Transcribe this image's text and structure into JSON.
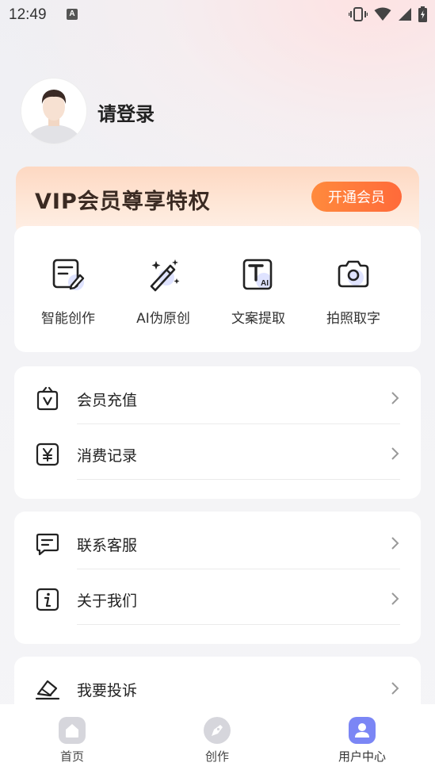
{
  "status_bar": {
    "time": "12:49",
    "notification_icon": "A"
  },
  "profile": {
    "login_label": "请登录"
  },
  "vip": {
    "title": "VIP会员尊享特权",
    "button_label": "开通会员",
    "accent": "#ff7a3c"
  },
  "tools": [
    {
      "label": "智能创作",
      "icon": "smart-create-icon"
    },
    {
      "label": "AI伪原创",
      "icon": "magic-wand-icon"
    },
    {
      "label": "文案提取",
      "icon": "text-extract-icon"
    },
    {
      "label": "拍照取字",
      "icon": "camera-icon"
    }
  ],
  "menu_group1": [
    {
      "label": "会员充值",
      "icon": "vip-recharge-icon"
    },
    {
      "label": "消费记录",
      "icon": "yen-record-icon"
    }
  ],
  "menu_group2": [
    {
      "label": "联系客服",
      "icon": "chat-service-icon"
    },
    {
      "label": "关于我们",
      "icon": "info-icon"
    }
  ],
  "menu_group3": [
    {
      "label": "我要投诉",
      "icon": "complaint-icon"
    }
  ],
  "tabbar": [
    {
      "label": "首页",
      "icon": "home-icon",
      "active": false
    },
    {
      "label": "创作",
      "icon": "pen-icon",
      "active": false
    },
    {
      "label": "用户中心",
      "icon": "user-icon",
      "active": true
    }
  ],
  "colors": {
    "tab_active": "#7b86f5",
    "tab_inactive": "#d0d0d6"
  }
}
